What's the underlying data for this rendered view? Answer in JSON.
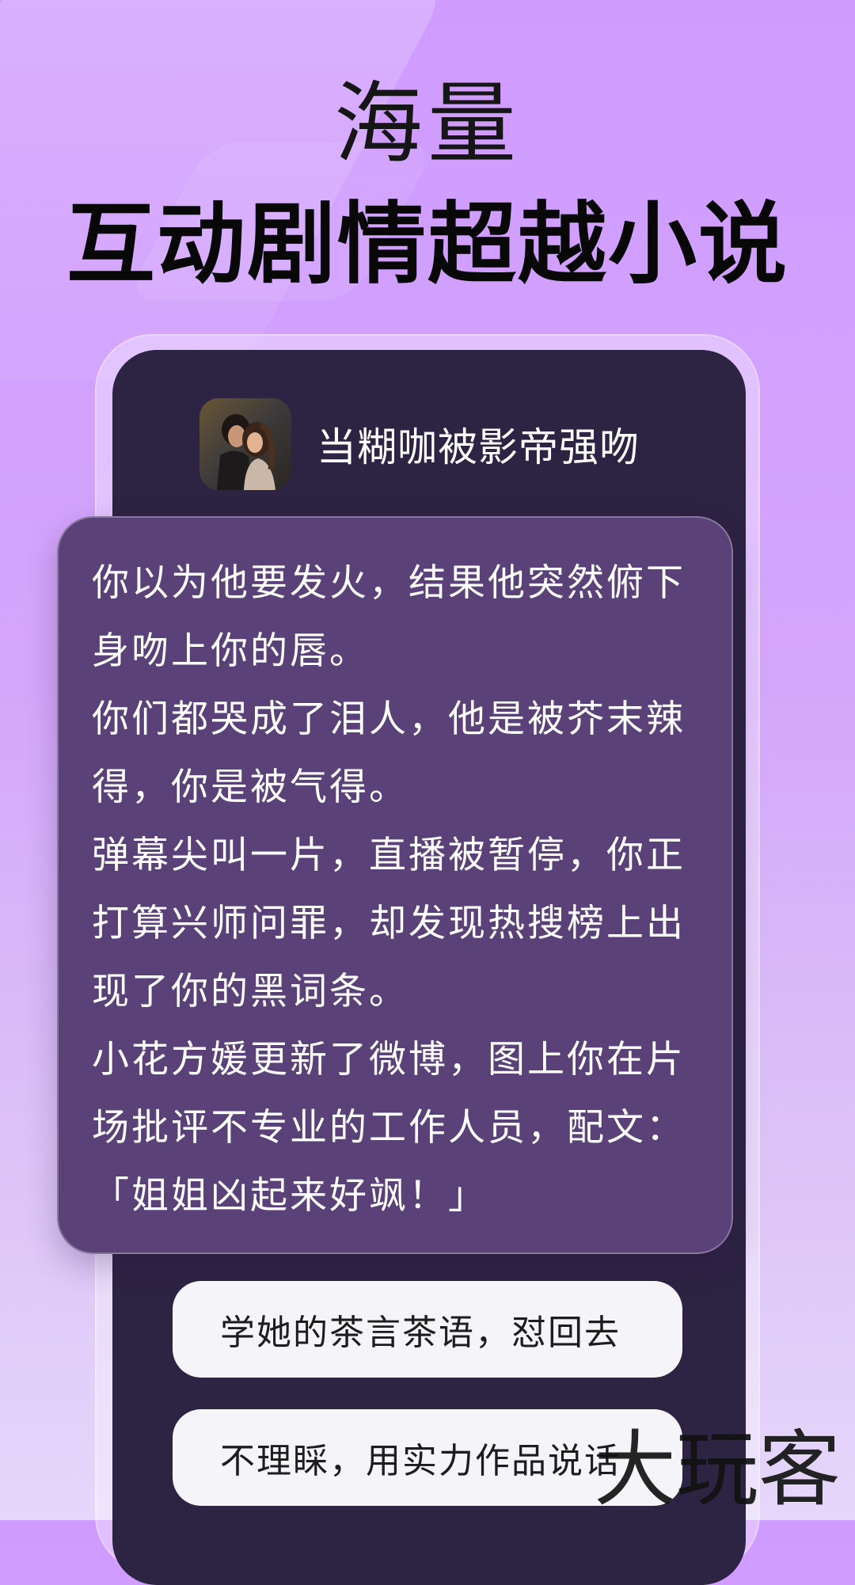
{
  "headline": {
    "top": "海量",
    "main": "互动剧情超越小说"
  },
  "story": {
    "title": "当糊咖被影帝强吻",
    "paragraphs": [
      "你以为他要发火，结果他突然俯下身吻上你的唇。",
      "你们都哭成了泪人，他是被芥末辣得，你是被气得。",
      "弹幕尖叫一片，直播被暂停，你正打算兴师问罪，却发现热搜榜上出现了你的黑词条。",
      "小花方媛更新了微博，图上你在片场批评不专业的工作人员，配文：「姐姐凶起来好飒！」"
    ]
  },
  "choices": [
    "学她的茶言茶语，怼回去",
    "不理睬，用实力作品说话"
  ],
  "watermark": "大玩客",
  "colors": {
    "background": "#d4a6fb",
    "phone": "#2d2343",
    "card": "#5a4278",
    "choice": "#f5f4f8"
  }
}
